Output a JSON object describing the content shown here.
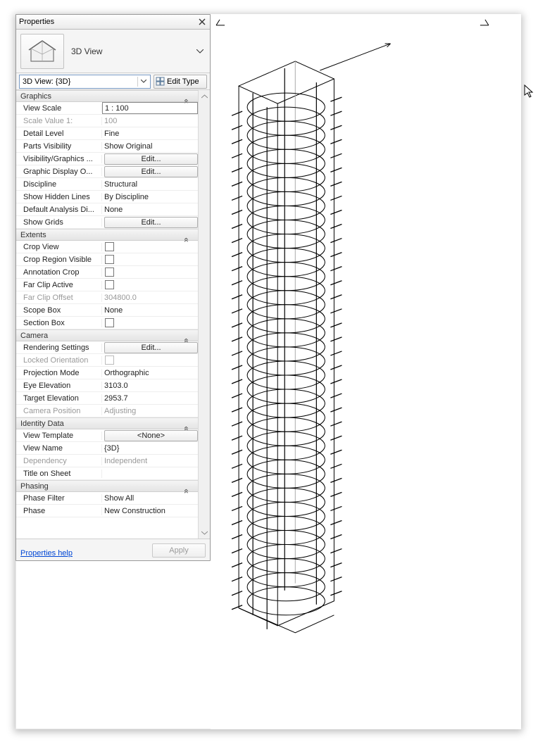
{
  "panel_title": "Properties",
  "type_selector": {
    "category": "3D View"
  },
  "instance_selector": {
    "value": "3D View: {3D}",
    "edit_type_label": "Edit Type"
  },
  "groups": [
    {
      "name": "Graphics",
      "rows": [
        {
          "label": "View Scale",
          "value": "1 : 100",
          "kind": "text",
          "boxed": true
        },
        {
          "label": "Scale Value    1:",
          "value": "100",
          "kind": "text",
          "disabled": true
        },
        {
          "label": "Detail Level",
          "value": "Fine",
          "kind": "text"
        },
        {
          "label": "Parts Visibility",
          "value": "Show Original",
          "kind": "text"
        },
        {
          "label": "Visibility/Graphics ...",
          "value": "Edit...",
          "kind": "button"
        },
        {
          "label": "Graphic Display O...",
          "value": "Edit...",
          "kind": "button"
        },
        {
          "label": "Discipline",
          "value": "Structural",
          "kind": "text"
        },
        {
          "label": "Show Hidden Lines",
          "value": "By Discipline",
          "kind": "text"
        },
        {
          "label": "Default Analysis Di...",
          "value": "None",
          "kind": "text"
        },
        {
          "label": "Show Grids",
          "value": "Edit...",
          "kind": "button"
        }
      ]
    },
    {
      "name": "Extents",
      "rows": [
        {
          "label": "Crop View",
          "value": "",
          "kind": "check",
          "checked": false
        },
        {
          "label": "Crop Region Visible",
          "value": "",
          "kind": "check",
          "checked": false
        },
        {
          "label": "Annotation Crop",
          "value": "",
          "kind": "check",
          "checked": false
        },
        {
          "label": "Far Clip Active",
          "value": "",
          "kind": "check",
          "checked": false
        },
        {
          "label": "Far Clip Offset",
          "value": "304800.0",
          "kind": "text",
          "disabled": true
        },
        {
          "label": "Scope Box",
          "value": "None",
          "kind": "text"
        },
        {
          "label": "Section Box",
          "value": "",
          "kind": "check",
          "checked": false
        }
      ]
    },
    {
      "name": "Camera",
      "rows": [
        {
          "label": "Rendering Settings",
          "value": "Edit...",
          "kind": "button"
        },
        {
          "label": "Locked Orientation",
          "value": "",
          "kind": "check",
          "checked": false,
          "disabled": true
        },
        {
          "label": "Projection Mode",
          "value": "Orthographic",
          "kind": "text"
        },
        {
          "label": "Eye Elevation",
          "value": "3103.0",
          "kind": "text"
        },
        {
          "label": "Target Elevation",
          "value": "2953.7",
          "kind": "text"
        },
        {
          "label": "Camera Position",
          "value": "Adjusting",
          "kind": "text",
          "disabled": true
        }
      ]
    },
    {
      "name": "Identity Data",
      "rows": [
        {
          "label": "View Template",
          "value": "<None>",
          "kind": "button"
        },
        {
          "label": "View Name",
          "value": "{3D}",
          "kind": "text"
        },
        {
          "label": "Dependency",
          "value": "Independent",
          "kind": "text",
          "disabled": true
        },
        {
          "label": "Title on Sheet",
          "value": "",
          "kind": "text"
        }
      ]
    },
    {
      "name": "Phasing",
      "rows": [
        {
          "label": "Phase Filter",
          "value": "Show All",
          "kind": "text"
        },
        {
          "label": "Phase",
          "value": "New Construction",
          "kind": "text"
        }
      ]
    }
  ],
  "footer": {
    "help": "Properties help",
    "apply": "Apply"
  }
}
